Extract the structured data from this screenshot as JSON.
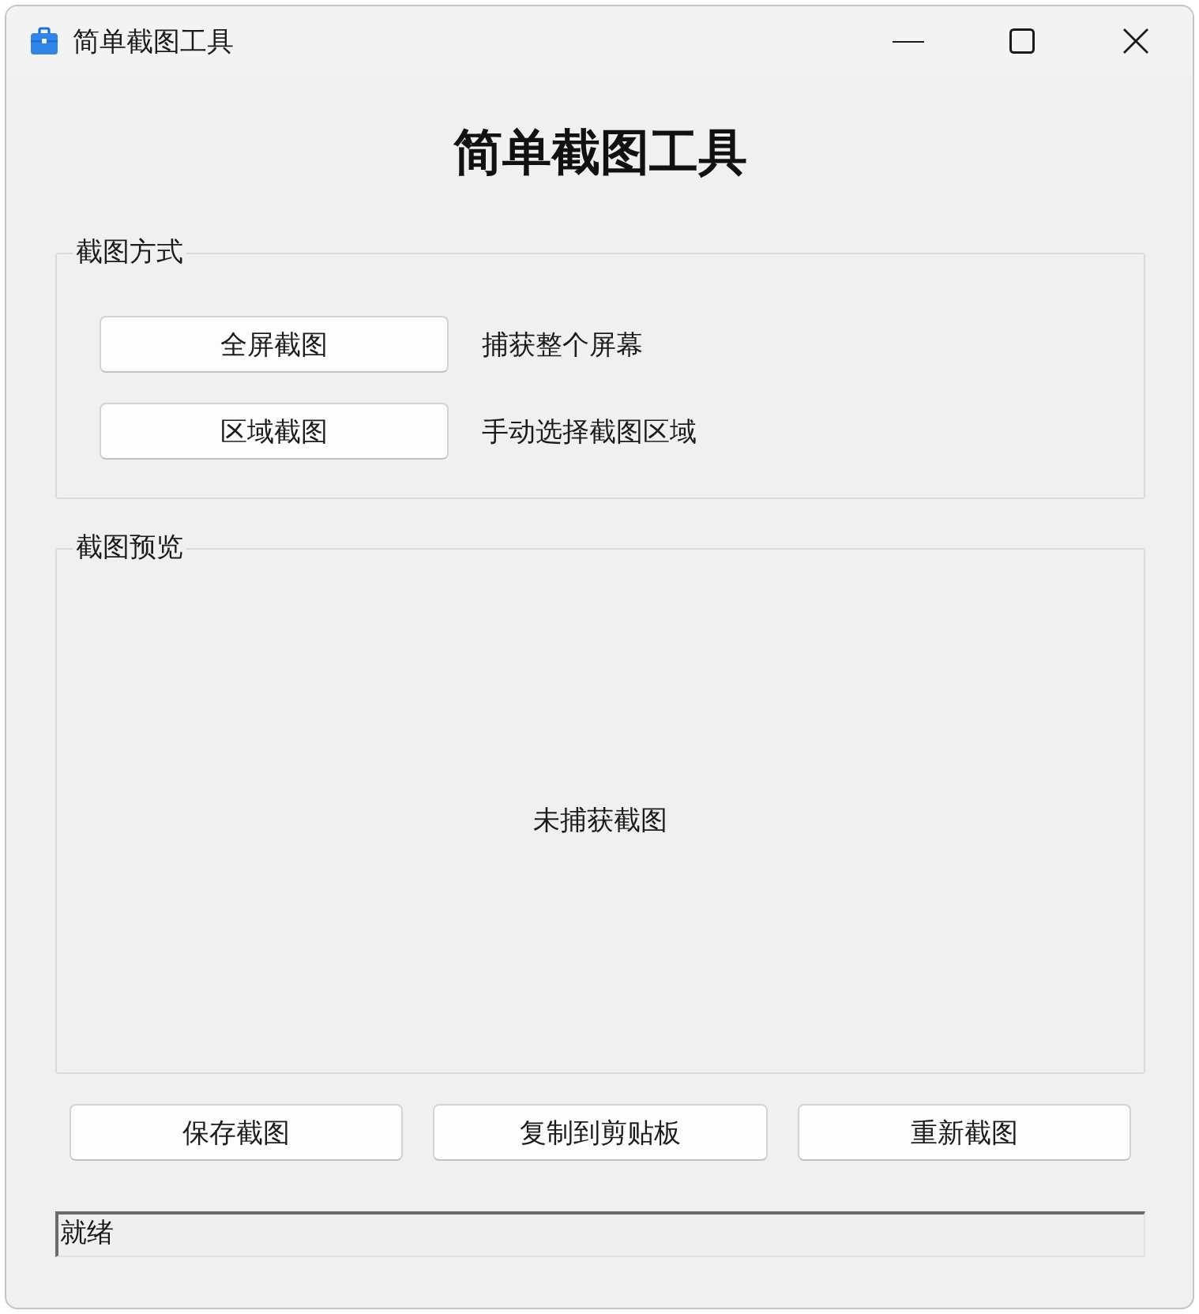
{
  "window": {
    "title": "简单截图工具"
  },
  "heading": "简单截图工具",
  "capture_mode": {
    "legend": "截图方式",
    "options": [
      {
        "button": "全屏截图",
        "description": "捕获整个屏幕"
      },
      {
        "button": "区域截图",
        "description": "手动选择截图区域"
      }
    ]
  },
  "preview": {
    "legend": "截图预览",
    "empty_text": "未捕获截图"
  },
  "actions": [
    "保存截图",
    "复制到剪贴板",
    "重新截图"
  ],
  "status_bar": {
    "text": "就绪"
  }
}
